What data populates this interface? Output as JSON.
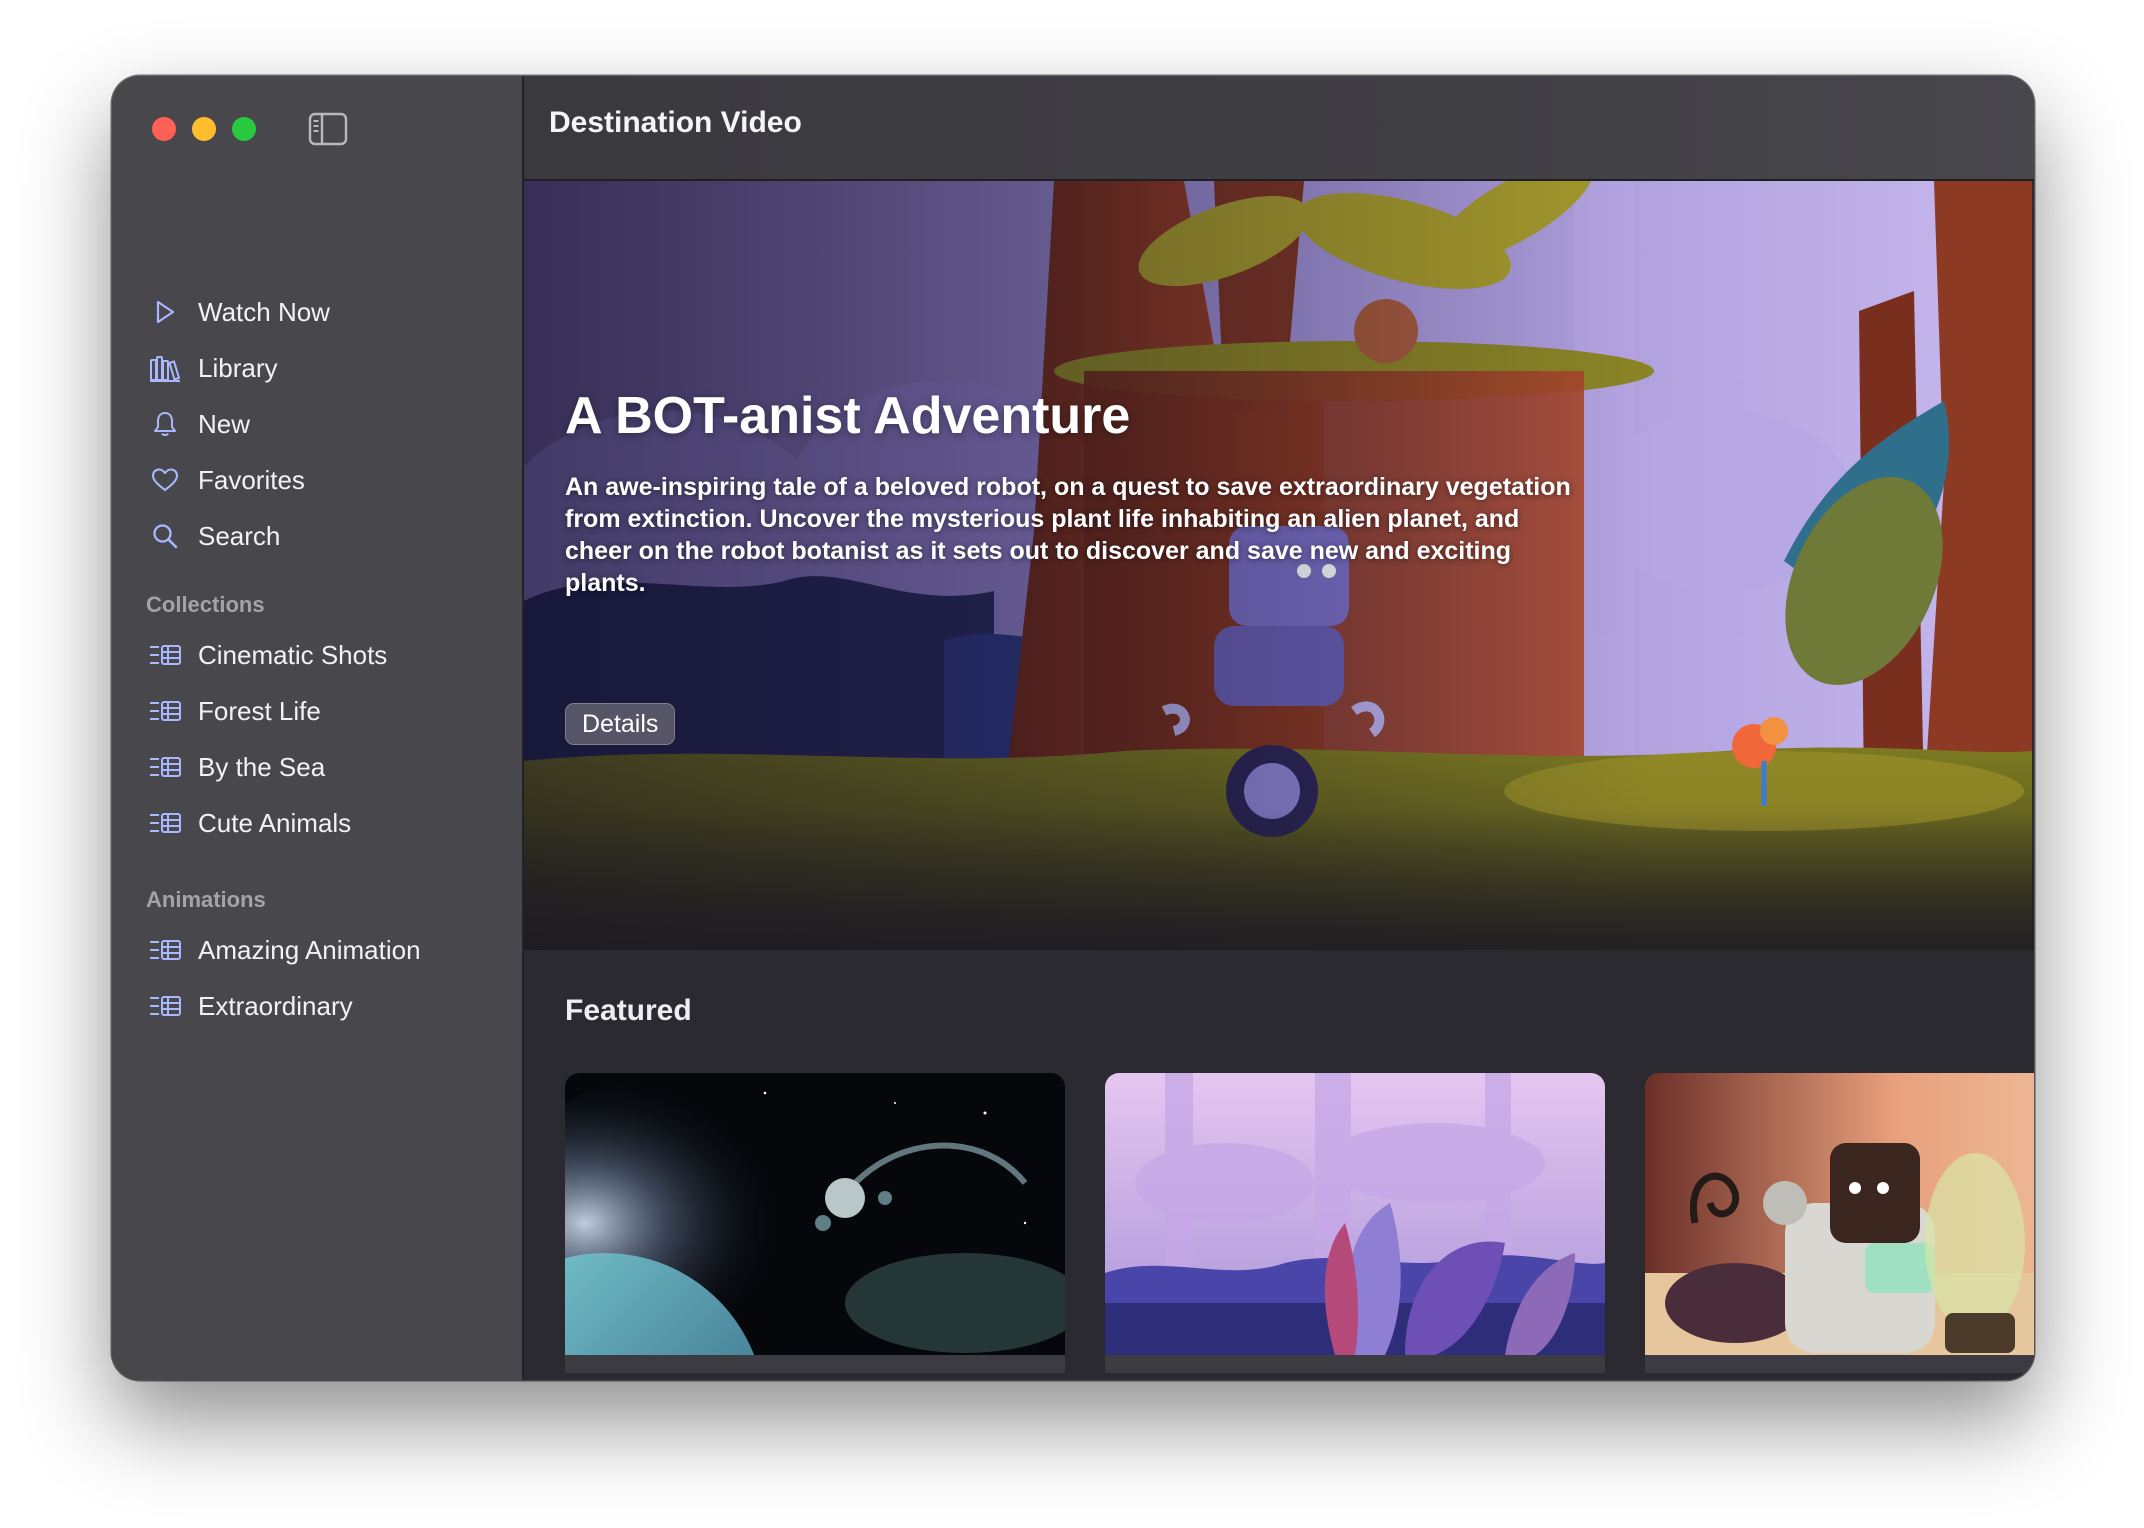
{
  "window": {
    "app_title": "Destination Video"
  },
  "sidebar": {
    "toggle_icon": "sidebar-toggle-icon",
    "main_items": [
      {
        "label": "Watch Now",
        "icon": "play-icon"
      },
      {
        "label": "Library",
        "icon": "library-books-icon"
      },
      {
        "label": "New",
        "icon": "bell-icon"
      },
      {
        "label": "Favorites",
        "icon": "heart-icon"
      },
      {
        "label": "Search",
        "icon": "magnifier-icon"
      }
    ],
    "collections_title": "Collections",
    "collections": [
      {
        "label": "Cinematic Shots",
        "icon": "film-list-icon"
      },
      {
        "label": "Forest Life",
        "icon": "film-list-icon"
      },
      {
        "label": "By the Sea",
        "icon": "film-list-icon"
      },
      {
        "label": "Cute Animals",
        "icon": "film-list-icon"
      }
    ],
    "animations_title": "Animations",
    "animations": [
      {
        "label": "Amazing Animation",
        "icon": "film-list-icon"
      },
      {
        "label": "Extraordinary",
        "icon": "film-list-icon"
      }
    ]
  },
  "hero": {
    "title": "A BOT-anist Adventure",
    "description": "An awe-inspiring tale of a beloved robot, on a quest to save extraordinary vegetation from extinction. Uncover the mysterious plant life inhabiting an alien planet, and cheer on the robot botanist as it sets out to discover and save new and exciting plants.",
    "button_label": "Details"
  },
  "featured": {
    "title": "Featured",
    "cards": [
      {
        "image": "space-planet-robot-thumbnail"
      },
      {
        "image": "purple-forest-plants-thumbnail"
      },
      {
        "image": "robot-lab-plant-thumbnail"
      }
    ]
  },
  "colors": {
    "traffic_red": "#fe5f57",
    "traffic_yellow": "#febc2e",
    "traffic_green": "#28c840",
    "sidebar_bg": "#48474b",
    "content_bg": "#2b2a30"
  }
}
